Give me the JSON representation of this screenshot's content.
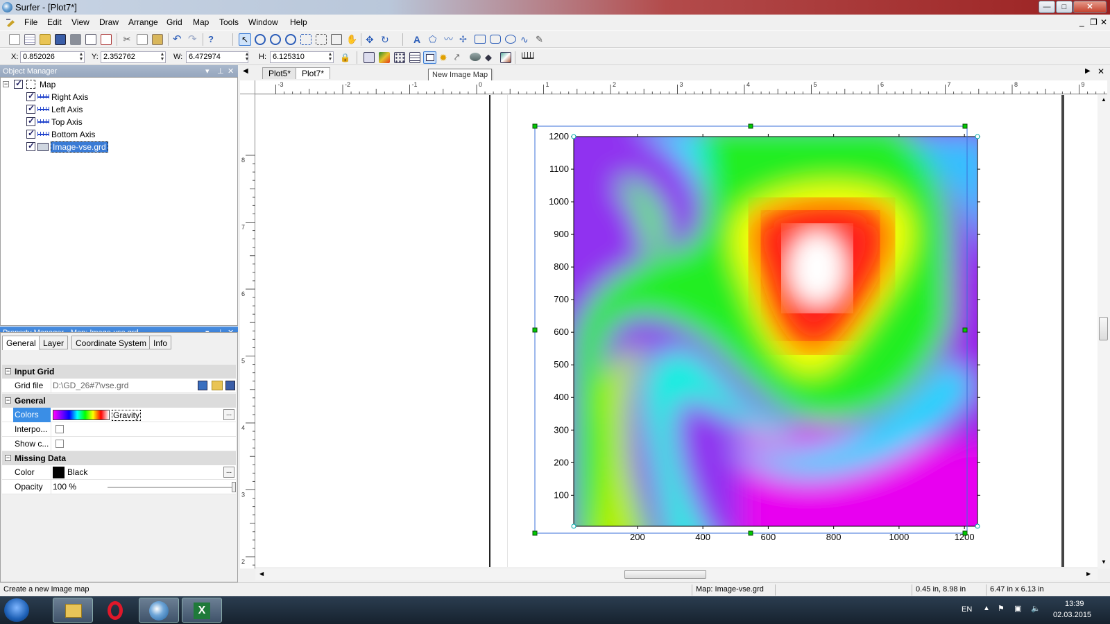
{
  "window": {
    "title": "Surfer - [Plot7*]",
    "minimize_glyph": "—",
    "maximize_glyph": "□",
    "close_glyph": "✕",
    "mdi_min": "_",
    "mdi_restore": "❐",
    "mdi_close": "✕"
  },
  "menu": {
    "items": [
      "File",
      "Edit",
      "View",
      "Draw",
      "Arrange",
      "Grid",
      "Map",
      "Tools",
      "Window",
      "Help"
    ]
  },
  "coords": {
    "x_label": "X:",
    "x_value": "0.852026",
    "y_label": "Y:",
    "y_value": "2.352762",
    "w_label": "W:",
    "w_value": "6.472974",
    "h_label": "H:",
    "h_value": "6.125310"
  },
  "object_manager": {
    "title": "Object Manager",
    "root": "Map",
    "items": [
      "Right Axis",
      "Left Axis",
      "Top Axis",
      "Bottom Axis",
      "Image-vse.grd"
    ]
  },
  "property_manager": {
    "title": "Property Manager - Map: Image-vse.grd",
    "tabs": [
      "General",
      "Layer",
      "Coordinate System",
      "Info"
    ],
    "sections": {
      "input_grid": "Input Grid",
      "general": "General",
      "missing_data": "Missing Data"
    },
    "grid_file_label": "Grid file",
    "grid_file_value": "D:\\GD_26#7\\vse.grd",
    "colors_label": "Colors",
    "colors_value": "Gravity",
    "interp_label": "Interpo...",
    "show_label": "Show c...",
    "color_label": "Color",
    "color_value": "Black",
    "opacity_label": "Opacity",
    "opacity_value": "100 %",
    "ellipsis": "..."
  },
  "doc_tabs": [
    "Plot5*",
    "Plot7*"
  ],
  "tooltip": "New Image Map",
  "ruler": {
    "top_labels": [
      "-3",
      "-2",
      "-1",
      "0",
      "1",
      "2",
      "3",
      "4",
      "5",
      "6",
      "7",
      "8",
      "9"
    ],
    "left_labels": [
      "8",
      "7",
      "6",
      "5",
      "4",
      "3",
      "2"
    ]
  },
  "map": {
    "y_ticks": [
      "1200",
      "1100",
      "1000",
      "900",
      "800",
      "700",
      "600",
      "500",
      "400",
      "300",
      "200",
      "100"
    ],
    "x_ticks": [
      "200",
      "400",
      "600",
      "800",
      "1000",
      "1200"
    ],
    "colors": {
      "low": "#ff00ff",
      "high": "#ffffff"
    }
  },
  "status": {
    "left": "Create a new Image map",
    "map": "Map: Image-vse.grd",
    "position": "0.45 in, 8.98 in",
    "size": "6.47 in x 6.13 in"
  },
  "taskbar": {
    "lang": "EN",
    "time": "13:39",
    "date": "02.03.2015"
  }
}
